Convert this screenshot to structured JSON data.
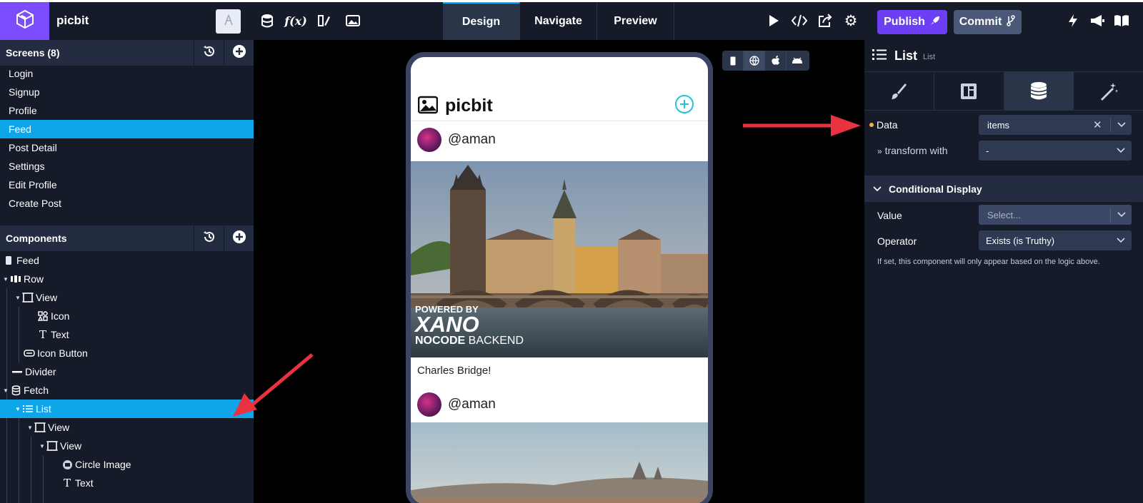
{
  "app": {
    "name": "picbit",
    "logo_icon": "cube-icon",
    "brand_color": "#7c4dff"
  },
  "toolbar": {
    "left_icons": [
      "database-icon",
      "function-icon",
      "assets-icon",
      "image-icon"
    ],
    "tabs": [
      {
        "label": "Design",
        "active": true
      },
      {
        "label": "Navigate",
        "active": false
      },
      {
        "label": "Preview",
        "active": false
      }
    ],
    "right_icons": [
      "play-icon",
      "code-icon",
      "share-icon",
      "settings-icon"
    ],
    "publish_label": "Publish",
    "commit_label": "Commit",
    "far_icons": [
      "bolt-icon",
      "megaphone-icon",
      "book-icon"
    ]
  },
  "sidebar": {
    "screens_title": "Screens (8)",
    "screens": [
      {
        "label": "Login",
        "active": false
      },
      {
        "label": "Signup",
        "active": false
      },
      {
        "label": "Profile",
        "active": false
      },
      {
        "label": "Feed",
        "active": true
      },
      {
        "label": "Post Detail",
        "active": false
      },
      {
        "label": "Settings",
        "active": false
      },
      {
        "label": "Edit Profile",
        "active": false
      },
      {
        "label": "Create Post",
        "active": false
      }
    ],
    "components_title": "Components",
    "tree": [
      {
        "label": "Feed",
        "icon": "phone-icon"
      },
      {
        "label": "Row",
        "icon": "row-icon"
      },
      {
        "label": "View",
        "icon": "view-icon"
      },
      {
        "label": "Icon",
        "icon": "icon-component-icon"
      },
      {
        "label": "Text",
        "icon": "text-icon"
      },
      {
        "label": "Icon Button",
        "icon": "button-icon"
      },
      {
        "label": "Divider",
        "icon": "divider-icon"
      },
      {
        "label": "Fetch",
        "icon": "database-icon"
      },
      {
        "label": "List",
        "icon": "list-icon"
      },
      {
        "label": "View",
        "icon": "view-icon"
      },
      {
        "label": "View",
        "icon": "view-icon"
      },
      {
        "label": "Circle Image",
        "icon": "circle-image-icon"
      },
      {
        "label": "Text",
        "icon": "text-icon"
      }
    ]
  },
  "phone": {
    "title": "picbit",
    "posts": [
      {
        "username": "@aman",
        "caption": "Charles Bridge!"
      },
      {
        "username": "@aman"
      }
    ],
    "image_overlay": {
      "line1": "POWERED BY",
      "line2": "XANO",
      "line3_bold": "NOCODE",
      "line3_rest": " BACKEND"
    }
  },
  "device_bar": [
    "mobile-icon",
    "web-icon",
    "apple-icon",
    "android-icon"
  ],
  "panel": {
    "title": "List",
    "subtitle": "List",
    "tab_icons": [
      "brush-icon",
      "layout-icon",
      "database-icon",
      "magic-wand-icon"
    ],
    "data_label": "Data",
    "data_value": "items",
    "transform_label": "transform with",
    "transform_value": "-",
    "conditional_title": "Conditional Display",
    "value_label": "Value",
    "value_placeholder": "Select...",
    "operator_label": "Operator",
    "operator_value": "Exists (is Truthy)",
    "help_text": "If set, this component will only appear based on the logic above."
  },
  "colors": {
    "accent": "#0ea5e9",
    "arrow": "#e8323f",
    "publish": "#6c3ff5",
    "commit": "#4b5877"
  }
}
